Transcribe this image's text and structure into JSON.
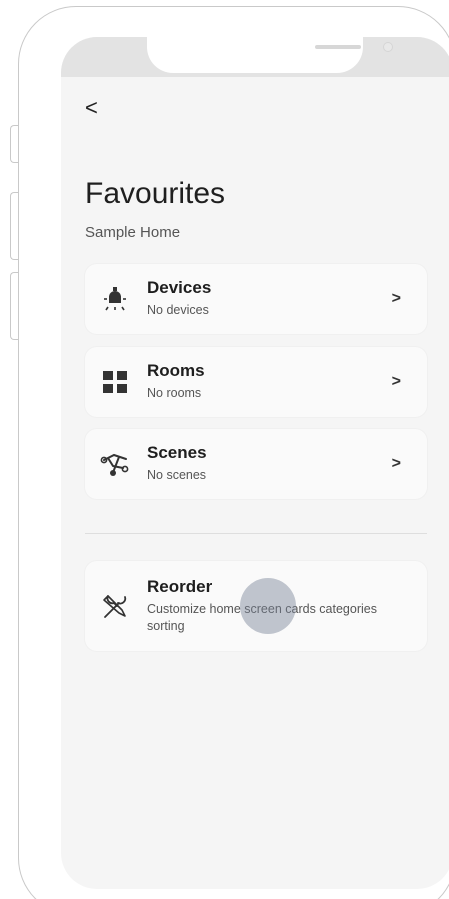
{
  "header": {
    "back_icon": "chevron-left-icon",
    "back_glyph": "<"
  },
  "page": {
    "title": "Favourites",
    "subtitle": "Sample Home"
  },
  "items": [
    {
      "label": "Devices",
      "description": "No devices",
      "icon": "bulb-icon"
    },
    {
      "label": "Rooms",
      "description": "No rooms",
      "icon": "grid-icon"
    },
    {
      "label": "Scenes",
      "description": "No scenes",
      "icon": "scenes-icon"
    }
  ],
  "reorder": {
    "label": "Reorder",
    "description": "Customize home screen cards categories sorting",
    "icon": "tools-icon"
  },
  "chevron_glyph": ">"
}
